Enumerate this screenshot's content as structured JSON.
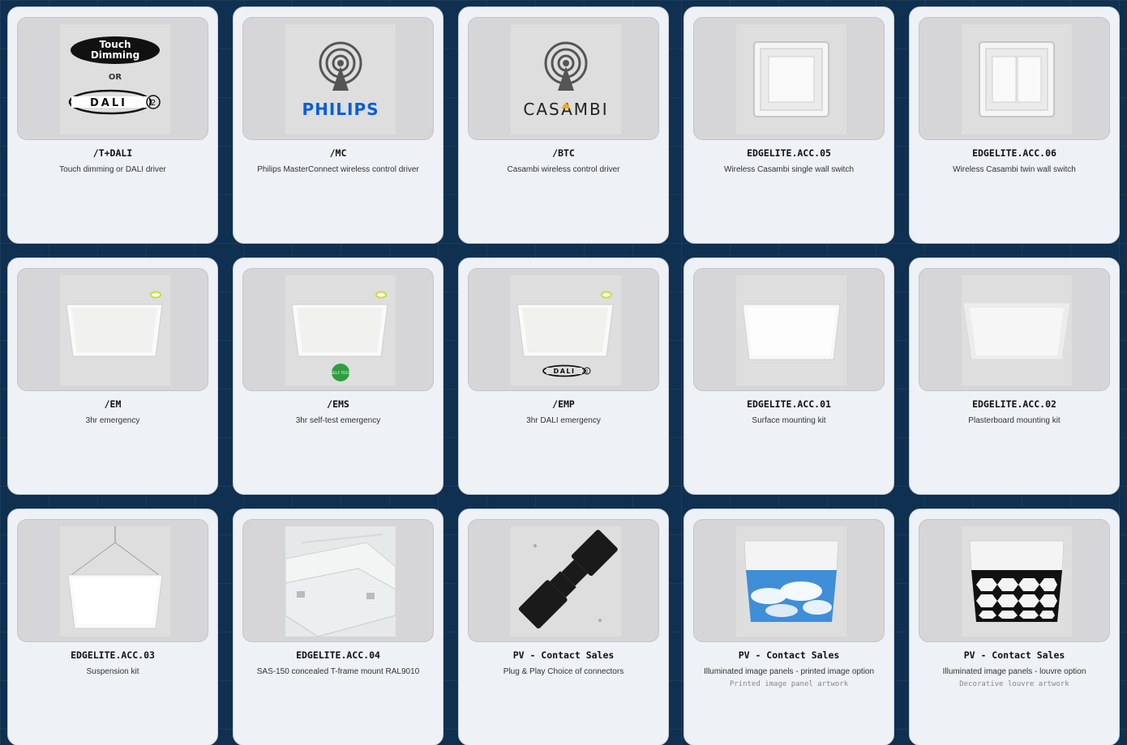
{
  "products": [
    {
      "code": "/T+DALI",
      "description": "Touch dimming or DALI driver",
      "note": "",
      "image": "touch-dimming-dali-logo",
      "logo_text": {
        "touch": "Touch",
        "dimming": "Dimming",
        "or": "OR",
        "dali": "DALI",
        "dali_version": "2"
      }
    },
    {
      "code": "/MC",
      "description": "Philips MasterConnect wireless control driver",
      "note": "",
      "image": "philips-wireless-logo",
      "logo_text": {
        "brand": "PHILIPS"
      }
    },
    {
      "code": "/BTC",
      "description": "Casambi wireless control driver",
      "note": "",
      "image": "casambi-wireless-logo",
      "logo_text": {
        "brand": "CASAMBI"
      }
    },
    {
      "code": "EDGELITE.ACC.05",
      "description": "Wireless Casambi single wall switch",
      "note": "",
      "image": "single-wall-switch"
    },
    {
      "code": "EDGELITE.ACC.06",
      "description": "Wireless Casambi twin wall switch",
      "note": "",
      "image": "twin-wall-switch"
    },
    {
      "code": "/EM",
      "description": "3hr emergency",
      "note": "",
      "image": "panel-emergency"
    },
    {
      "code": "/EMS",
      "description": "3hr self-test emergency",
      "note": "",
      "image": "panel-self-test",
      "logo_text": {
        "badge": "SELF TEST"
      }
    },
    {
      "code": "/EMP",
      "description": "3hr DALI emergency",
      "note": "",
      "image": "panel-dali-emergency",
      "logo_text": {
        "dali": "DALI",
        "dali_version": "2"
      }
    },
    {
      "code": "EDGELITE.ACC.01",
      "description": "Surface mounting kit",
      "note": "",
      "image": "surface-mount-panel"
    },
    {
      "code": "EDGELITE.ACC.02",
      "description": "Plasterboard mounting kit",
      "note": "",
      "image": "plasterboard-panel"
    },
    {
      "code": "EDGELITE.ACC.03",
      "description": "Suspension kit",
      "note": "",
      "image": "suspension-panel"
    },
    {
      "code": "EDGELITE.ACC.04",
      "description": "SAS-150 concealed T-frame mount RAL9010",
      "note": "",
      "image": "t-frame-mount"
    },
    {
      "code": "PV - Contact Sales",
      "description": "Plug & Play Choice of connectors",
      "note": "",
      "image": "plug-connector"
    },
    {
      "code": "PV - Contact Sales",
      "description": "Illuminated image panels - printed image option",
      "note": "Printed image panel artwork",
      "image": "printed-sky-panel"
    },
    {
      "code": "PV - Contact Sales",
      "description": "Illuminated image panels - louvre option",
      "note": "Decorative louvre artwork",
      "image": "louvre-panel"
    }
  ],
  "colors": {
    "page_bg": "#0f3050",
    "card_bg": "#eef1f6",
    "thumb_bg": "#d6d6d8",
    "philips_blue": "#0b5ed7",
    "casambi_accent": "#f5a623"
  }
}
